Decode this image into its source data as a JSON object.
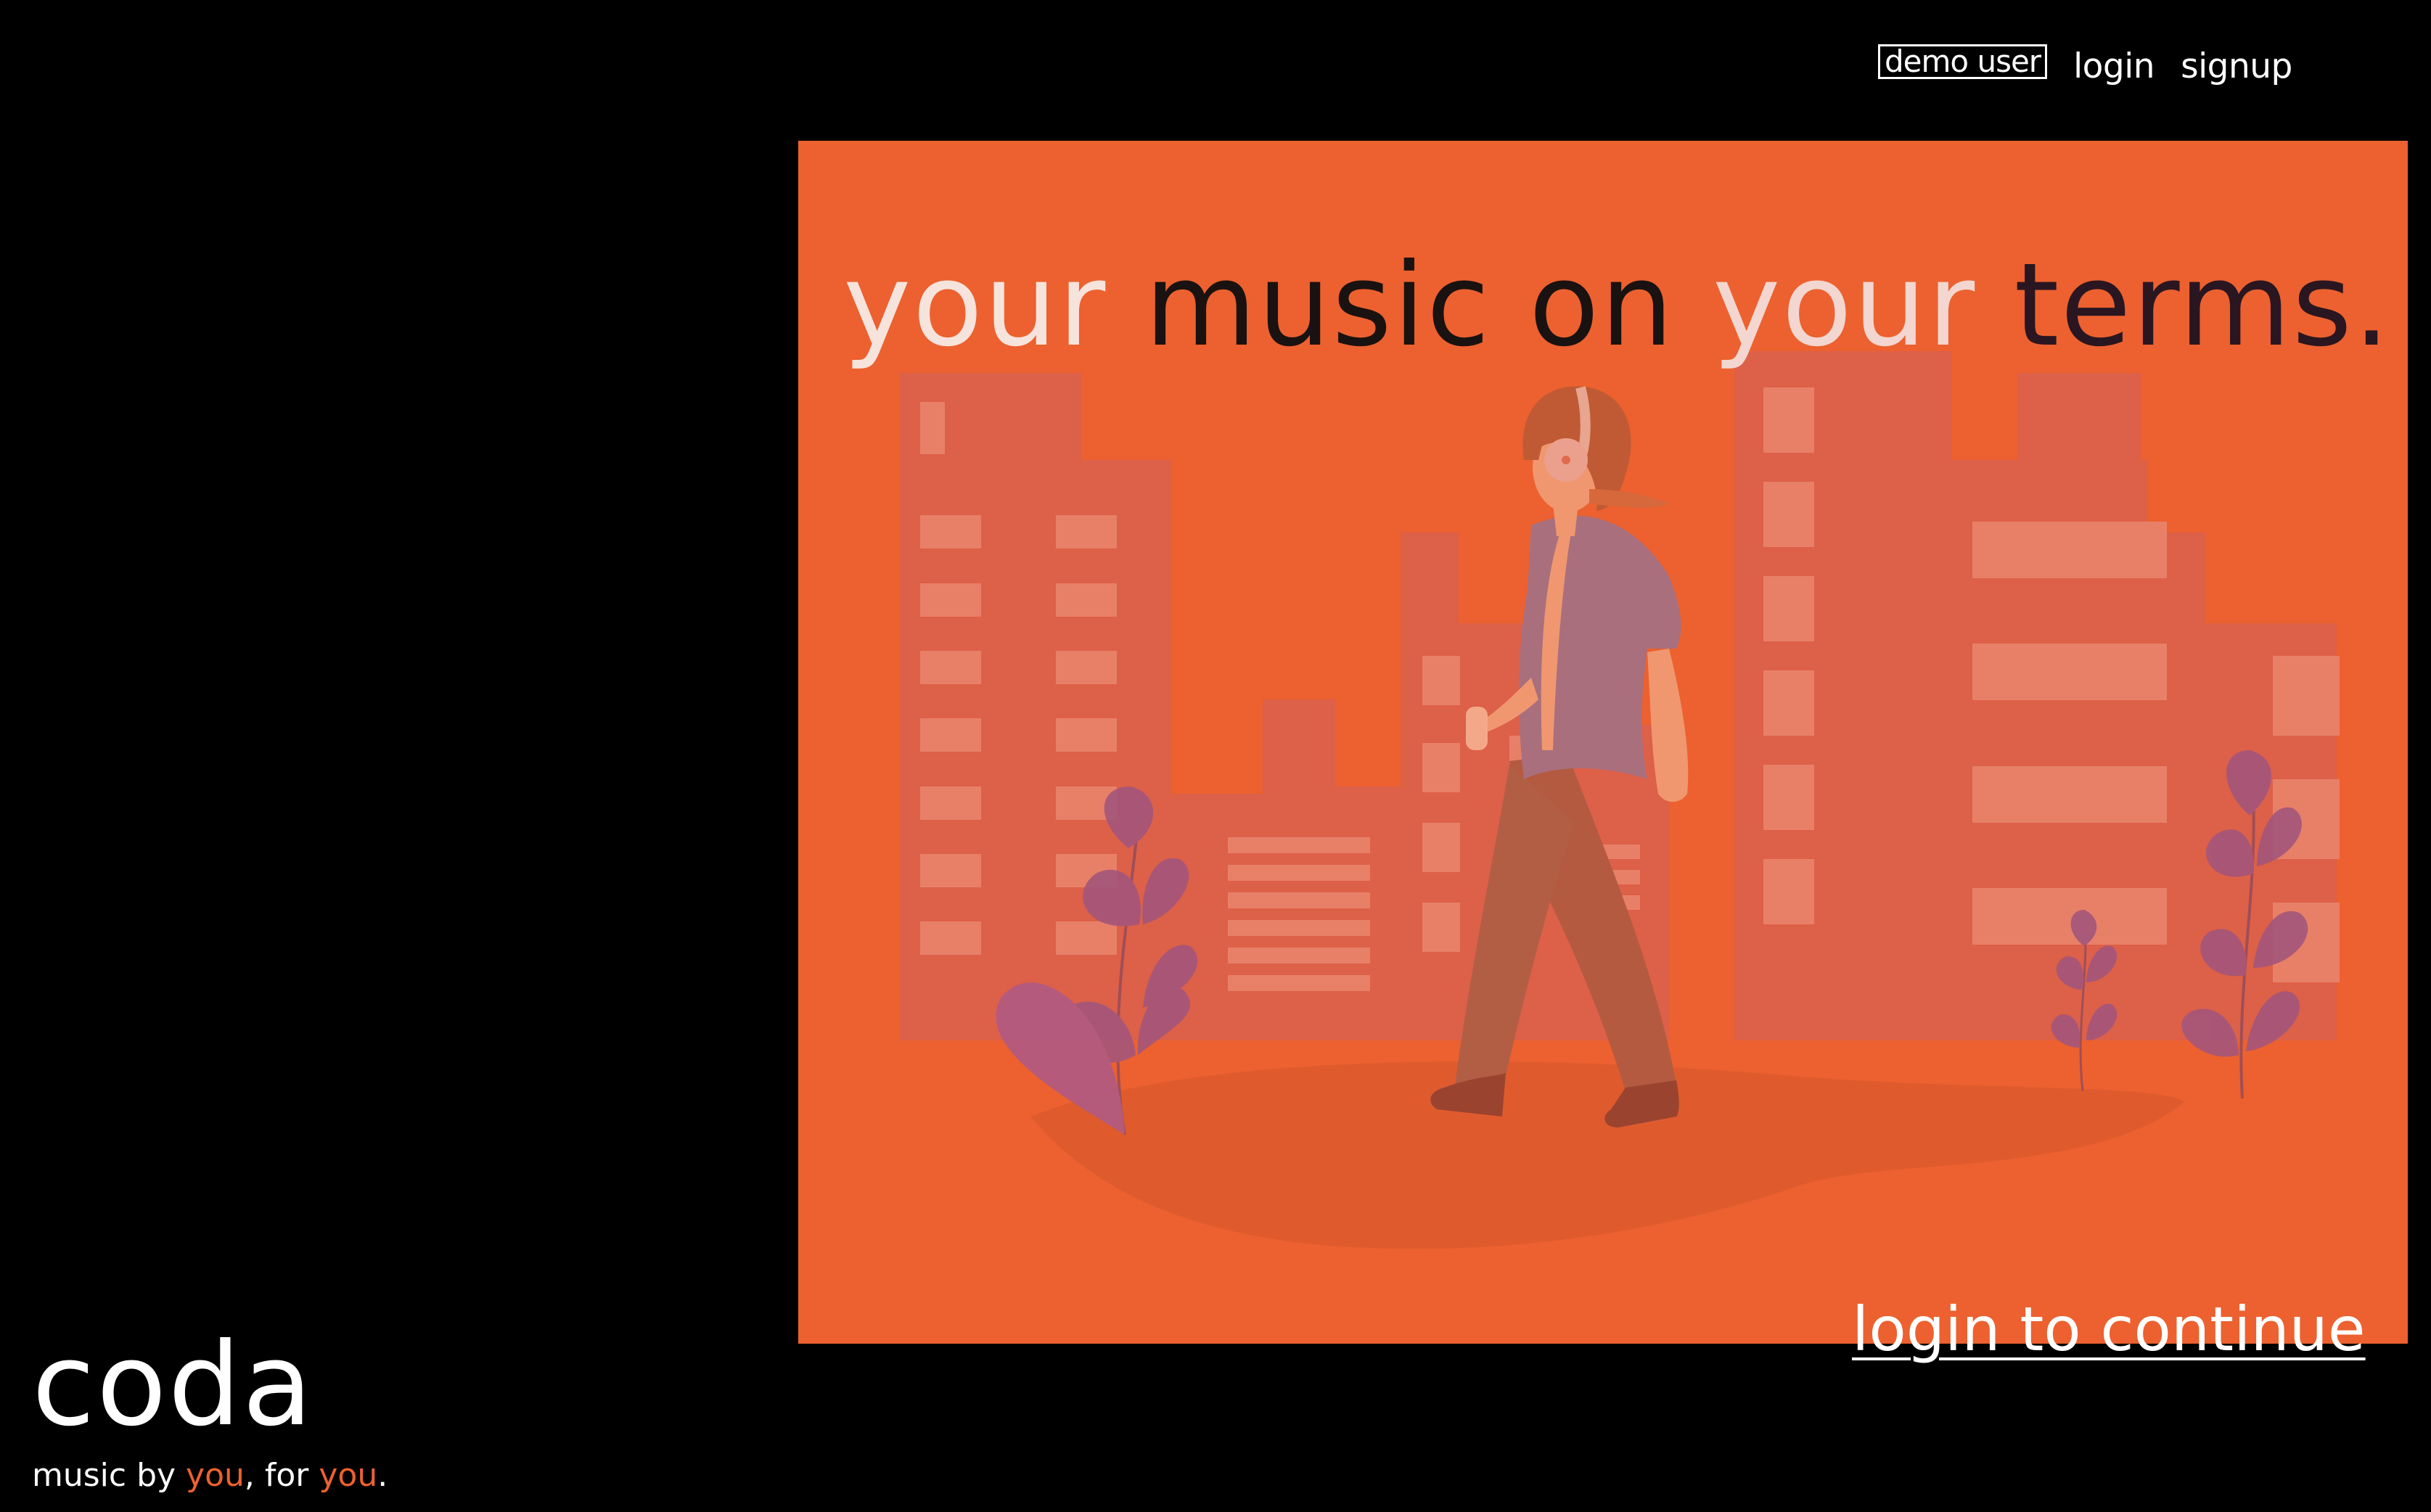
{
  "nav": {
    "demo_label": "demo user",
    "login_label": "login",
    "signup_label": "signup"
  },
  "hero": {
    "headline_words": [
      "your",
      "music",
      "on",
      "your",
      "terms."
    ],
    "cta_label": "login to continue"
  },
  "brand": {
    "logo": "coda",
    "tagline_part1": "music by ",
    "tagline_you1": "you",
    "tagline_part2": ", for ",
    "tagline_you2": "you",
    "tagline_end": "."
  },
  "colors": {
    "background": "#000000",
    "accent": "#ec612f",
    "text": "#ffffff"
  },
  "icons": {
    "hero_illustration": "person-walking-with-headphones-city"
  }
}
